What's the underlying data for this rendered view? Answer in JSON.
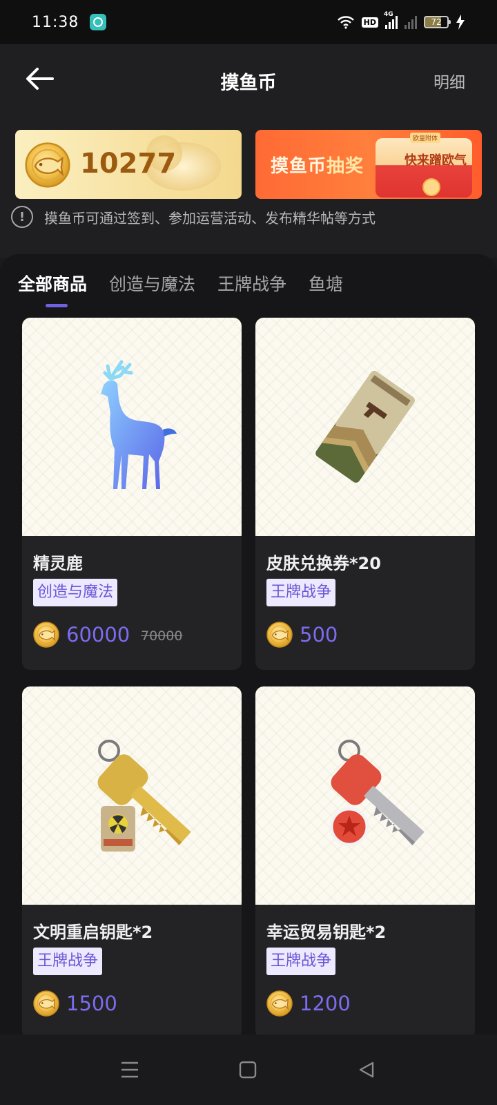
{
  "status_bar": {
    "time": "11:38",
    "hd_label": "HD",
    "network_label": "4G",
    "battery_level": "72",
    "icons": [
      "app-icon",
      "wifi-icon",
      "signal-icon",
      "signal-dim-icon",
      "battery-icon",
      "charging-icon"
    ]
  },
  "header": {
    "title": "摸鱼币",
    "detail_link": "明细",
    "back_icon": "arrow-left-icon"
  },
  "balance": {
    "amount": "10277"
  },
  "lottery": {
    "title_part1": "摸鱼币",
    "title_part2": "抽奖",
    "tag": "欧皇附体",
    "cta": "快来蹭欧气"
  },
  "info": {
    "icon": "exclamation-icon",
    "text": "摸鱼币可通过签到、参加运营活动、发布精华帖等方式"
  },
  "tabs": [
    {
      "label": "全部商品",
      "active": true
    },
    {
      "label": "创造与魔法",
      "active": false
    },
    {
      "label": "王牌战争",
      "active": false
    },
    {
      "label": "鱼塘",
      "active": false
    }
  ],
  "products": [
    {
      "name": "精灵鹿",
      "tag": "创造与魔法",
      "price": "60000",
      "original_price": "70000",
      "image": "spirit-deer"
    },
    {
      "name": "皮肤兑换券*20",
      "tag": "王牌战争",
      "price": "500",
      "image": "skin-voucher"
    },
    {
      "name": "文明重启钥匙*2",
      "tag": "王牌战争",
      "price": "1500",
      "image": "yellow-key"
    },
    {
      "name": "幸运贸易钥匙*2",
      "tag": "王牌战争",
      "price": "1200",
      "image": "red-key"
    }
  ],
  "colors": {
    "accent": "#7c6cf0",
    "tag_bg": "#ede9ff",
    "coin_gold": "#f2c94c"
  },
  "nav": {
    "icons": [
      "menu-icon",
      "home-icon",
      "back-triangle-icon"
    ]
  }
}
